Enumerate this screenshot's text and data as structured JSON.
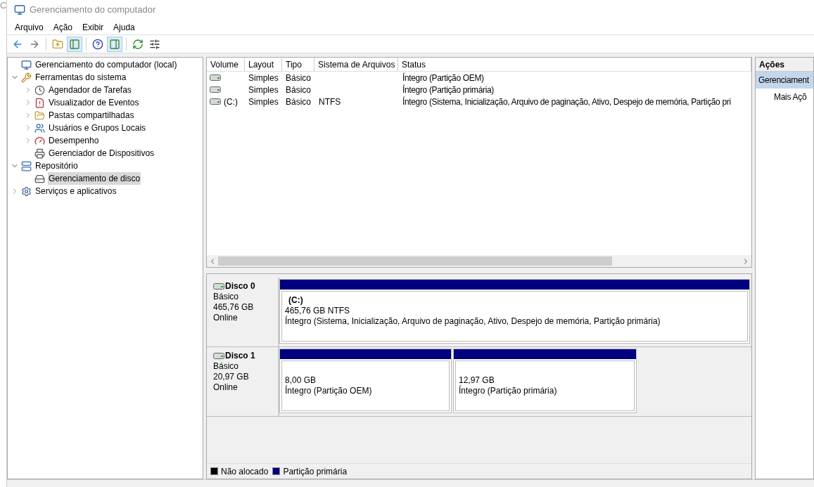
{
  "behind_window": {
    "text": "C"
  },
  "window": {
    "title": "Gerenciamento do computador"
  },
  "menu": [
    "Arquivo",
    "Ação",
    "Exibir",
    "Ajuda"
  ],
  "toolbar": [
    {
      "kind": "back",
      "on": false
    },
    {
      "kind": "forward",
      "on": false
    },
    {
      "kind": "up",
      "on": false
    },
    {
      "kind": "pane",
      "on": true
    },
    {
      "kind": "help",
      "on": false
    },
    {
      "kind": "pane2",
      "on": true
    },
    {
      "kind": "refresh",
      "on": false
    },
    {
      "kind": "props",
      "on": false
    }
  ],
  "tree": [
    {
      "label": "Gerenciamento do computador (local)",
      "selected": false,
      "children": [
        {
          "label": "Ferramentas do sistema",
          "expanded": true,
          "selected": false,
          "children": [
            {
              "label": "Agendador de Tarefas",
              "expanded": false,
              "selected": false
            },
            {
              "label": "Visualizador de Eventos",
              "expanded": false,
              "selected": false
            },
            {
              "label": "Pastas compartilhadas",
              "expanded": false,
              "selected": false
            },
            {
              "label": "Usuários e Grupos Locais",
              "expanded": false,
              "selected": false
            },
            {
              "label": "Desempenho",
              "expanded": false,
              "selected": false
            },
            {
              "label": "Gerenciador de Dispositivos",
              "selected": false
            }
          ]
        },
        {
          "label": "Repositório",
          "expanded": true,
          "selected": false,
          "children": [
            {
              "label": "Gerenciamento de disco",
              "selected": true
            }
          ]
        },
        {
          "label": "Serviços e aplicativos",
          "expanded": false,
          "selected": false
        }
      ]
    }
  ],
  "volumes": {
    "columns": [
      "Volume",
      "Layout",
      "Tipo",
      "Sistema de Arquivos",
      "Status"
    ],
    "rows": [
      {
        "layout": "Simples",
        "type": "Básico",
        "status": "Íntegro (Partição OEM)"
      },
      {
        "layout": "Simples",
        "type": "Básico",
        "status": "Íntegro (Partição primária)"
      },
      {
        "volume": "(C:)",
        "layout": "Simples",
        "type": "Básico",
        "filesystem": "NTFS",
        "status": "Íntegro (Sistema, Inicialização, Arquivo de paginação, Ativo, Despejo de memória, Partição pri"
      }
    ]
  },
  "disks": [
    {
      "name": "Disco 0",
      "type": "Básico",
      "size": "465,76 GB",
      "state": "Online",
      "partitions": [
        {
          "label": "(C:)",
          "size": "465,76 GB NTFS",
          "status": "Íntegro (Sistema, Inicialização, Arquivo de paginação, Ativo, Despejo de memória, Partição primária)"
        }
      ]
    },
    {
      "name": "Disco 1",
      "type": "Básico",
      "size": "20,97 GB",
      "state": "Online",
      "partitions": [
        {
          "size": "8,00 GB",
          "status": "Íntegro (Partição OEM)"
        },
        {
          "size": "12,97 GB",
          "status": "Íntegro (Partição primária)"
        }
      ]
    }
  ],
  "legend": [
    {
      "label": "Não alocado",
      "color": "#000000"
    },
    {
      "label": "Partição primária",
      "color": "#000080"
    }
  ],
  "actions": {
    "title": "Ações",
    "items": [
      {
        "label": "Gerenciament",
        "selected": true
      },
      {
        "label": "Mais Açõ",
        "selected": false
      }
    ]
  }
}
